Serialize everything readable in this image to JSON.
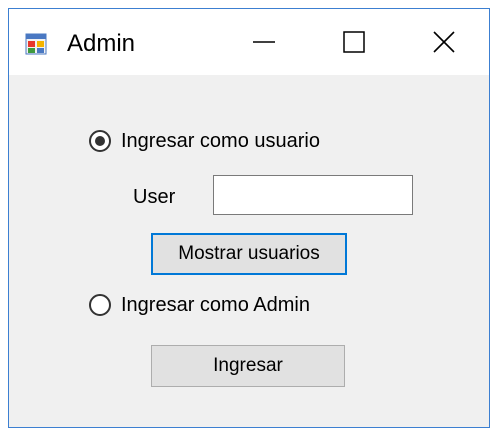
{
  "window": {
    "title": "Admin",
    "icon": "windows-form-icon",
    "controls": {
      "minimize_icon": "minimize-icon",
      "maximize_icon": "maximize-icon",
      "close_icon": "close-icon"
    },
    "border_color": "#3c7fd1"
  },
  "form": {
    "radio_user": {
      "label": "Ingresar como usuario",
      "checked": true
    },
    "user_field": {
      "label": "User",
      "value": ""
    },
    "show_users_button": {
      "label": "Mostrar usuarios",
      "focused": true,
      "focus_color": "#0078d7"
    },
    "radio_admin": {
      "label": "Ingresar como Admin",
      "checked": false
    },
    "enter_button": {
      "label": "Ingresar"
    }
  }
}
